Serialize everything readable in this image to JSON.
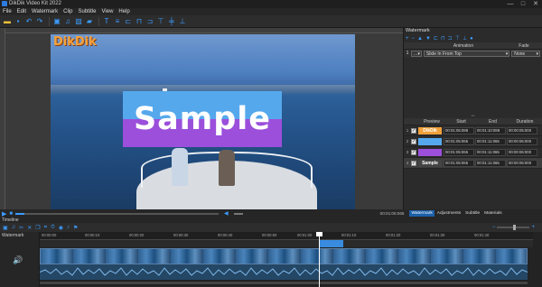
{
  "window": {
    "title": "DikDik Video Kit 2022",
    "controls": [
      "—",
      "□",
      "✕"
    ]
  },
  "menu": [
    "File",
    "Edit",
    "Watermark",
    "Clip",
    "Subtitle",
    "View",
    "Help"
  ],
  "preview": {
    "logo_watermark": "DikDik",
    "sample_watermark": "Sample"
  },
  "watermark_panel": {
    "title": "Watermark",
    "animation_header": {
      "animation": "Animation",
      "fade": "Fade"
    },
    "animation_row": {
      "index": "1",
      "in_style": "...",
      "animation": "Slide In From Top",
      "fade": "None"
    },
    "list_header": {
      "preview": "Preview",
      "start": "Start",
      "end": "End",
      "duration": "Duration"
    },
    "rows": [
      {
        "index": "1",
        "preview_text": "DikDik",
        "start": "00:01:05:088",
        "end": "00:01:10:088",
        "duration": "00:00:05:000"
      },
      {
        "index": "2",
        "preview_text": "",
        "start": "00:01:05:065",
        "end": "00:01:11:065",
        "duration": "00:00:06:000"
      },
      {
        "index": "3",
        "preview_text": "",
        "start": "00:01:05:065",
        "end": "00:01:11:065",
        "duration": "00:00:06:000"
      },
      {
        "index": "4",
        "preview_text": "Sample",
        "start": "00:01:05:065",
        "end": "00:01:11:065",
        "duration": "00:00:06:000"
      }
    ]
  },
  "transport": {
    "timecode": "00:01:05:065",
    "tabs": [
      {
        "label": "Watermark",
        "active": true
      },
      {
        "label": "Adjustments",
        "active": false
      },
      {
        "label": "Subtitle",
        "active": false
      },
      {
        "label": "Materials",
        "active": false
      }
    ]
  },
  "timeline": {
    "label": "Timeline",
    "track_label": "Watermark",
    "ruler": [
      "00:00:00",
      "00:00:10",
      "00:00:20",
      "00:00:30",
      "00:00:40",
      "00:00:50",
      "00:01:00",
      "00:01:10",
      "00:01:20",
      "00:01:30",
      "00:01:40"
    ]
  },
  "colors": {
    "accent": "#3b9cff",
    "logo": "#f6a23a",
    "sample_top": "#56a8ec",
    "sample_bottom": "#9b4fdb"
  }
}
